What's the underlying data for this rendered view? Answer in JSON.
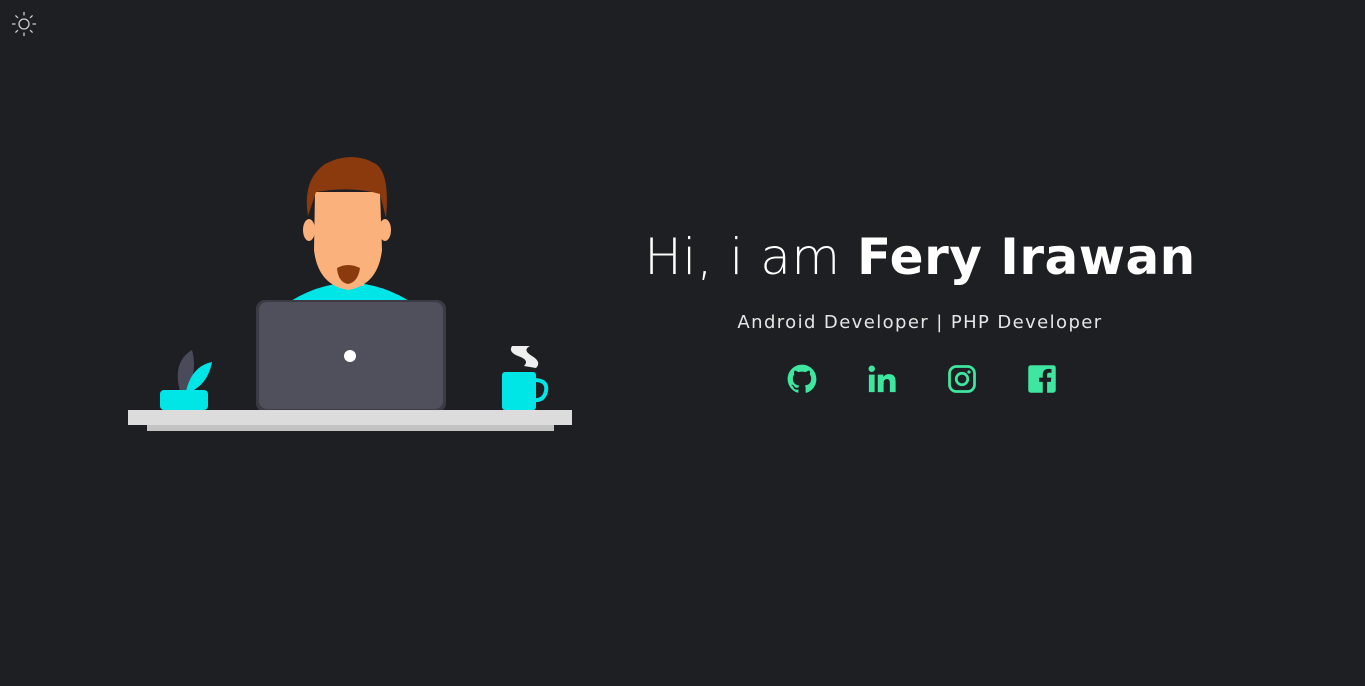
{
  "header": {
    "theme_toggle_icon": "sun-icon"
  },
  "hero": {
    "greeting_prefix": "Hi, i am",
    "name": "Fery Irawan",
    "subtitle": "Android Developer | PHP Developer"
  },
  "socials": [
    {
      "name": "github",
      "icon": "github-icon"
    },
    {
      "name": "linkedin",
      "icon": "linkedin-icon"
    },
    {
      "name": "instagram",
      "icon": "instagram-icon"
    },
    {
      "name": "facebook",
      "icon": "facebook-icon"
    }
  ],
  "colors": {
    "background": "#1e1f23",
    "accent": "#3ee6a0",
    "cyan": "#00e5e5",
    "laptop": "#4f505c",
    "hair": "#8b3a0e",
    "skin": "#fbb17c",
    "desk": "#dcdcdc"
  }
}
